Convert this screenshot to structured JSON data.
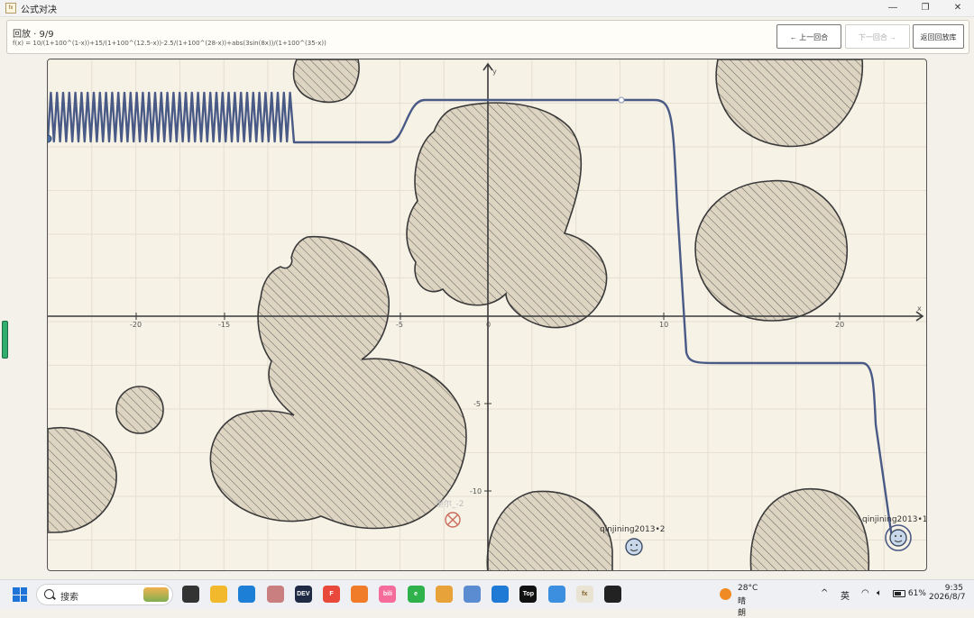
{
  "window": {
    "title": "公式对决",
    "app_icon": "fx"
  },
  "header": {
    "replay_title": "回放 · 9/9",
    "formula": "f(x) = 10/(1+100^(1-x))+15/(1+100^(12.5-x))-2.5/(1+100^(28-x))+abs(3sin(8x))/(1+100^(35-x))",
    "prev_label": "← 上一回合",
    "next_label": "下一回合 →",
    "back_label": "返回回放库"
  },
  "board": {
    "x_axis_label": "x",
    "y_axis_label": "y",
    "x_ticks": [
      "-20",
      "-15",
      "-5",
      "0",
      "10",
      "20"
    ],
    "y_ticks": [
      "-5",
      "-10"
    ],
    "players": [
      {
        "name": "墨尔_-2",
        "status": "eliminated"
      },
      {
        "name": "qinjining2013•2",
        "status": "alive"
      },
      {
        "name": "qinjining2013•1",
        "status": "alive"
      }
    ]
  },
  "taskbar": {
    "search_placeholder": "搜索",
    "weather_temp": "28°C",
    "weather_desc": "晴朗",
    "ime": "英",
    "battery": "61%",
    "time": "9:35",
    "date": "2026/8/7",
    "apps": [
      {
        "name": "task-view",
        "color": "#333333",
        "label": ""
      },
      {
        "name": "file-explorer",
        "color": "#f2b92c",
        "label": ""
      },
      {
        "name": "edge",
        "color": "#1d7fd6",
        "label": ""
      },
      {
        "name": "avatar-app",
        "color": "#c97f7f",
        "label": ""
      },
      {
        "name": "dev",
        "color": "#1f2a44",
        "label": "DEV"
      },
      {
        "name": "f-app",
        "color": "#e8493a",
        "label": "F"
      },
      {
        "name": "slash-app",
        "color": "#f07c2a",
        "label": ""
      },
      {
        "name": "bilibili",
        "color": "#f56b9a",
        "label": "bili"
      },
      {
        "name": "e-app",
        "color": "#2fb24c",
        "label": "e"
      },
      {
        "name": "notes-app",
        "color": "#e8a23a",
        "label": ""
      },
      {
        "name": "gear-app",
        "color": "#5b8bd1",
        "label": ""
      },
      {
        "name": "vscode",
        "color": "#1f7ad6",
        "label": ""
      },
      {
        "name": "top-app",
        "color": "#111111",
        "label": "Top"
      },
      {
        "name": "notepad",
        "color": "#3c8fde",
        "label": ""
      },
      {
        "name": "formula-app",
        "color": "#e9e3d3",
        "label": "fx"
      },
      {
        "name": "qq",
        "color": "#222222",
        "label": ""
      }
    ]
  }
}
